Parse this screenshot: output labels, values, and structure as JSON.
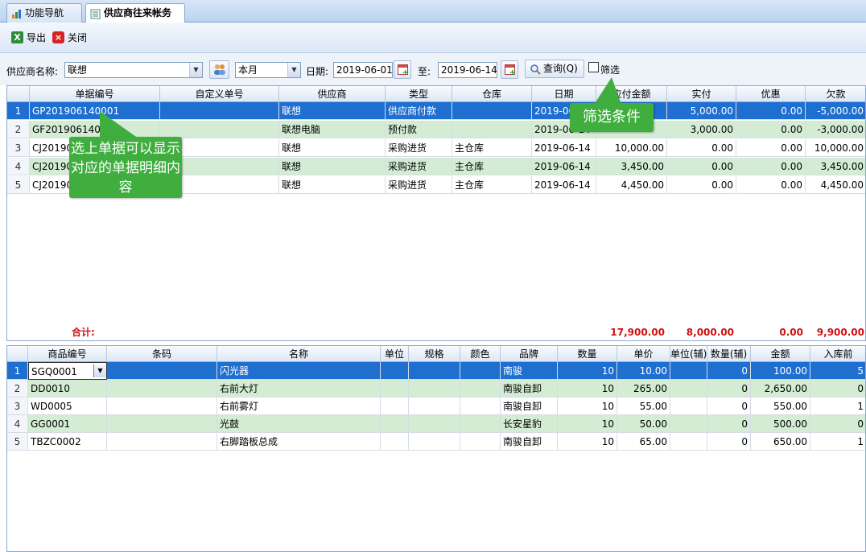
{
  "tabs": [
    {
      "label": "功能导航",
      "icon": "navigation-icon"
    },
    {
      "label": "供应商往来帐务",
      "icon": "ledger-icon"
    }
  ],
  "toolbar": {
    "export_label": "导出",
    "close_label": "关闭"
  },
  "filter": {
    "supplier_label": "供应商名称:",
    "supplier_value": "联想",
    "period_value": "本月",
    "date_label": "日期:",
    "date_from": "2019-06-01",
    "to_label": "至:",
    "date_to": "2019-06-14",
    "query_label": "查询(Q)",
    "filter_label": "筛选",
    "filter_checked": false
  },
  "master": {
    "columns": [
      "单据编号",
      "自定义单号",
      "供应商",
      "类型",
      "仓库",
      "日期",
      "应付金额",
      "实付",
      "优惠",
      "欠款"
    ],
    "rows": [
      {
        "no": "1",
        "doc": "GP201906140001",
        "custom": "",
        "supplier": "联想",
        "type": "供应商付款",
        "warehouse": "",
        "date": "2019-06-14",
        "payable": "",
        "paid": "5,000.00",
        "discount": "0.00",
        "debt": "-5,000.00"
      },
      {
        "no": "2",
        "doc": "GF201906140001",
        "custom": "",
        "supplier": "联想电脑",
        "type": "预付款",
        "warehouse": "",
        "date": "2019-06-14",
        "payable": "",
        "paid": "3,000.00",
        "discount": "0.00",
        "debt": "-3,000.00"
      },
      {
        "no": "3",
        "doc": "CJ201906140001",
        "custom": "",
        "supplier": "联想",
        "type": "采购进货",
        "warehouse": "主仓库",
        "date": "2019-06-14",
        "payable": "10,000.00",
        "paid": "0.00",
        "discount": "0.00",
        "debt": "10,000.00"
      },
      {
        "no": "4",
        "doc": "CJ201906140002",
        "custom": "",
        "supplier": "联想",
        "type": "采购进货",
        "warehouse": "主仓库",
        "date": "2019-06-14",
        "payable": "3,450.00",
        "paid": "0.00",
        "discount": "0.00",
        "debt": "3,450.00"
      },
      {
        "no": "5",
        "doc": "CJ201906140003",
        "custom": "",
        "supplier": "联想",
        "type": "采购进货",
        "warehouse": "主仓库",
        "date": "2019-06-14",
        "payable": "4,450.00",
        "paid": "0.00",
        "discount": "0.00",
        "debt": "4,450.00"
      }
    ],
    "totals": {
      "label": "合计:",
      "payable": "17,900.00",
      "paid": "8,000.00",
      "discount": "0.00",
      "debt": "9,900.00"
    }
  },
  "detail": {
    "columns": [
      "商品编号",
      "条码",
      "名称",
      "单位",
      "规格",
      "颜色",
      "品牌",
      "数量",
      "单价",
      "单位(辅)",
      "数量(辅)",
      "金额",
      "入库前"
    ],
    "rows": [
      {
        "no": "1",
        "code": "SGQ0001",
        "barcode": "",
        "name": "闪光器",
        "unit": "",
        "spec": "",
        "color": "",
        "brand": "南骏",
        "qty": "10",
        "price": "10.00",
        "unit2": "",
        "qty2": "0",
        "amount": "100.00",
        "before": "5"
      },
      {
        "no": "2",
        "code": "DD0010",
        "barcode": "",
        "name": "右前大灯",
        "unit": "",
        "spec": "",
        "color": "",
        "brand": "南骏自卸",
        "qty": "10",
        "price": "265.00",
        "unit2": "",
        "qty2": "0",
        "amount": "2,650.00",
        "before": "0"
      },
      {
        "no": "3",
        "code": "WD0005",
        "barcode": "",
        "name": "右前雾灯",
        "unit": "",
        "spec": "",
        "color": "",
        "brand": "南骏自卸",
        "qty": "10",
        "price": "55.00",
        "unit2": "",
        "qty2": "0",
        "amount": "550.00",
        "before": "1"
      },
      {
        "no": "4",
        "code": "GG0001",
        "barcode": "",
        "name": "光鼓",
        "unit": "",
        "spec": "",
        "color": "",
        "brand": "长安星豹",
        "qty": "10",
        "price": "50.00",
        "unit2": "",
        "qty2": "0",
        "amount": "500.00",
        "before": "0"
      },
      {
        "no": "5",
        "code": "TBZC0002",
        "barcode": "",
        "name": "右脚踏板总成",
        "unit": "",
        "spec": "",
        "color": "",
        "brand": "南骏自卸",
        "qty": "10",
        "price": "65.00",
        "unit2": "",
        "qty2": "0",
        "amount": "650.00",
        "before": "1"
      }
    ]
  },
  "callouts": {
    "select_hint": "选上单据可以显示对应的单据明细内容",
    "filter_hint": "筛选条件"
  },
  "colors": {
    "selected": "#1e6fd0",
    "row_alt": "#d4ecd4",
    "total": "#d01010",
    "callout": "#3fae3f"
  }
}
